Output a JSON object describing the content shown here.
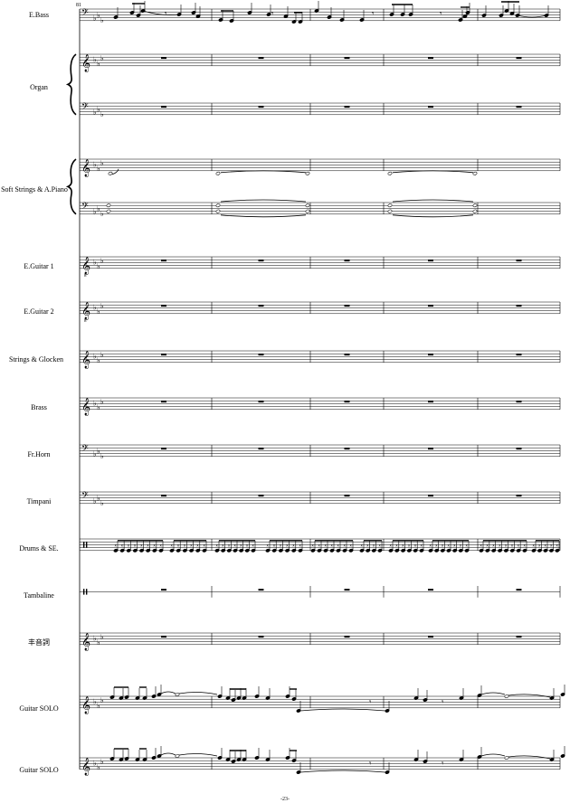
{
  "page": {
    "measure_number": "81",
    "page_number": "-23-"
  },
  "instruments": [
    {
      "name": "E.Bass",
      "clef": "bass",
      "staves": 1
    },
    {
      "name": "Organ",
      "clef": "treble+bass",
      "staves": 2
    },
    {
      "name": "Soft Strings & A.Piano",
      "clef": "treble+bass",
      "staves": 2
    },
    {
      "name": "E.Guitar 1",
      "clef": "treble-8",
      "staves": 1
    },
    {
      "name": "E.Guitar 2",
      "clef": "treble-8",
      "staves": 1
    },
    {
      "name": "Strings & Glocken",
      "clef": "treble",
      "staves": 1
    },
    {
      "name": "Brass",
      "clef": "treble",
      "staves": 1
    },
    {
      "name": "Fr.Horn",
      "clef": "bass",
      "staves": 1
    },
    {
      "name": "Timpani",
      "clef": "bass",
      "staves": 1
    },
    {
      "name": "Drums & SE.",
      "clef": "percussion",
      "staves": 1
    },
    {
      "name": "Tambaline",
      "clef": "percussion",
      "staves": 1
    },
    {
      "name": "丰音詞",
      "clef": "treble",
      "staves": 1
    },
    {
      "name": "Guitar SOLO",
      "clef": "treble",
      "staves": 1
    },
    {
      "name": "Guitar SOLO",
      "clef": "treble",
      "staves": 1
    }
  ],
  "colors": {
    "ink": "#000000",
    "paper": "#ffffff"
  }
}
